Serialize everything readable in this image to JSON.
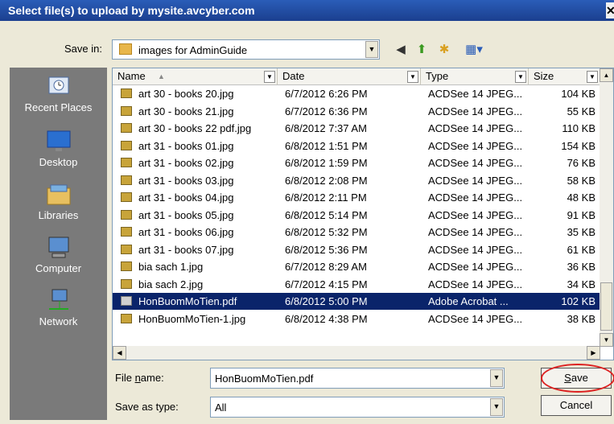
{
  "title": "Select file(s) to upload by mysite.avcyber.com",
  "close_glyph": "✕",
  "save_in": {
    "label": "Save in:",
    "value": "images for AdminGuide"
  },
  "toolbar": [
    "back-icon",
    "up-folder-icon",
    "new-folder-icon",
    "view-menu-icon"
  ],
  "places": [
    {
      "label": "Recent Places",
      "icon": "recent-places-icon"
    },
    {
      "label": "Desktop",
      "icon": "desktop-icon"
    },
    {
      "label": "Libraries",
      "icon": "libraries-icon"
    },
    {
      "label": "Computer",
      "icon": "computer-icon"
    },
    {
      "label": "Network",
      "icon": "network-icon"
    }
  ],
  "columns": [
    "Name",
    "Date",
    "Type",
    "Size"
  ],
  "files": [
    {
      "name": "art 30 - books 20.jpg",
      "date": "6/7/2012 6:26 PM",
      "type": "ACDSee 14 JPEG...",
      "size": "104 KB",
      "icon": "jpg"
    },
    {
      "name": "art 30 - books 21.jpg",
      "date": "6/7/2012 6:36 PM",
      "type": "ACDSee 14 JPEG...",
      "size": "55 KB",
      "icon": "jpg"
    },
    {
      "name": "art 30 - books 22 pdf.jpg",
      "date": "6/8/2012 7:37 AM",
      "type": "ACDSee 14 JPEG...",
      "size": "110 KB",
      "icon": "jpg"
    },
    {
      "name": "art 31 - books 01.jpg",
      "date": "6/8/2012 1:51 PM",
      "type": "ACDSee 14 JPEG...",
      "size": "154 KB",
      "icon": "jpg"
    },
    {
      "name": "art 31 - books 02.jpg",
      "date": "6/8/2012 1:59 PM",
      "type": "ACDSee 14 JPEG...",
      "size": "76 KB",
      "icon": "jpg"
    },
    {
      "name": "art 31 - books 03.jpg",
      "date": "6/8/2012 2:08 PM",
      "type": "ACDSee 14 JPEG...",
      "size": "58 KB",
      "icon": "jpg"
    },
    {
      "name": "art 31 - books 04.jpg",
      "date": "6/8/2012 2:11 PM",
      "type": "ACDSee 14 JPEG...",
      "size": "48 KB",
      "icon": "jpg"
    },
    {
      "name": "art 31 - books 05.jpg",
      "date": "6/8/2012 5:14 PM",
      "type": "ACDSee 14 JPEG...",
      "size": "91 KB",
      "icon": "jpg"
    },
    {
      "name": "art 31 - books 06.jpg",
      "date": "6/8/2012 5:32 PM",
      "type": "ACDSee 14 JPEG...",
      "size": "35 KB",
      "icon": "jpg"
    },
    {
      "name": "art 31 - books 07.jpg",
      "date": "6/8/2012 5:36 PM",
      "type": "ACDSee 14 JPEG...",
      "size": "61 KB",
      "icon": "jpg"
    },
    {
      "name": "bia sach 1.jpg",
      "date": "6/7/2012 8:29 AM",
      "type": "ACDSee 14 JPEG...",
      "size": "36 KB",
      "icon": "jpg"
    },
    {
      "name": "bia sach 2.jpg",
      "date": "6/7/2012 4:15 PM",
      "type": "ACDSee 14 JPEG...",
      "size": "34 KB",
      "icon": "jpg"
    },
    {
      "name": "HonBuomMoTien.pdf",
      "date": "6/8/2012 5:00 PM",
      "type": "Adobe Acrobat ...",
      "size": "102 KB",
      "icon": "pdf",
      "selected": true
    },
    {
      "name": "HonBuomMoTien-1.jpg",
      "date": "6/8/2012 4:38 PM",
      "type": "ACDSee 14 JPEG...",
      "size": "38 KB",
      "icon": "jpg"
    }
  ],
  "file_name": {
    "label_pre": "File ",
    "label_key": "n",
    "label_post": "ame:",
    "value": "HonBuomMoTien.pdf"
  },
  "save_as_type": {
    "label": "Save as type:",
    "value": "All"
  },
  "buttons": {
    "save_key": "S",
    "save_rest": "ave",
    "cancel": "Cancel"
  },
  "colors": {
    "selection": "#0a246a",
    "highlight_oval": "#dd2222",
    "title_bar": "#2a5db8"
  }
}
